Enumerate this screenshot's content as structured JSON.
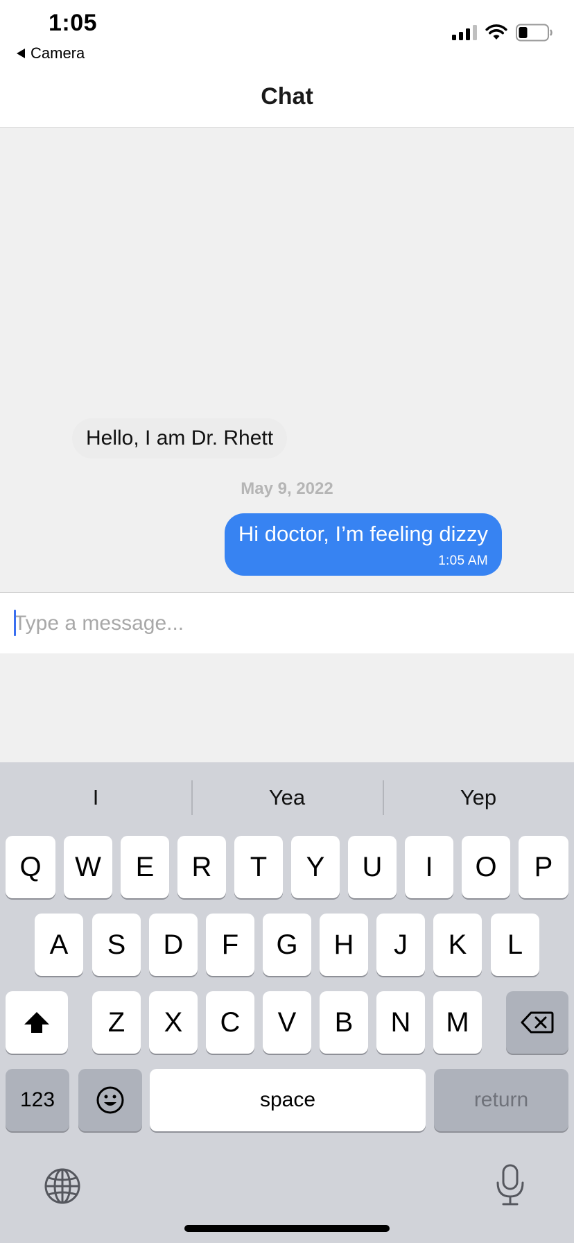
{
  "status_bar": {
    "time": "1:05",
    "back_label": "Camera",
    "icons": [
      "cellular-signal-icon",
      "wifi-icon",
      "battery-icon"
    ]
  },
  "nav": {
    "title": "Chat"
  },
  "messages": {
    "incoming": "Hello, I am Dr. Rhett",
    "date_separator": "May 9, 2022",
    "outgoing": {
      "text": "Hi doctor, I’m feeling dizzy",
      "time": "1:05 AM"
    }
  },
  "composer": {
    "placeholder": "Type a message..."
  },
  "keyboard": {
    "suggestions": [
      "I",
      "Yea",
      "Yep"
    ],
    "row1": [
      "Q",
      "W",
      "E",
      "R",
      "T",
      "Y",
      "U",
      "I",
      "O",
      "P"
    ],
    "row2": [
      "A",
      "S",
      "D",
      "F",
      "G",
      "H",
      "J",
      "K",
      "L"
    ],
    "row3": [
      "Z",
      "X",
      "C",
      "V",
      "B",
      "N",
      "M"
    ],
    "numbers_label": "123",
    "space_label": "space",
    "return_label": "return",
    "icons": [
      "shift-icon",
      "backspace-icon",
      "emoji-icon",
      "globe-icon",
      "microphone-icon"
    ]
  },
  "colors": {
    "outgoing_bubble": "#3783f2",
    "incoming_bubble": "#ececec",
    "keyboard_bg": "#d1d3d9",
    "caret": "#3a6ff0"
  }
}
